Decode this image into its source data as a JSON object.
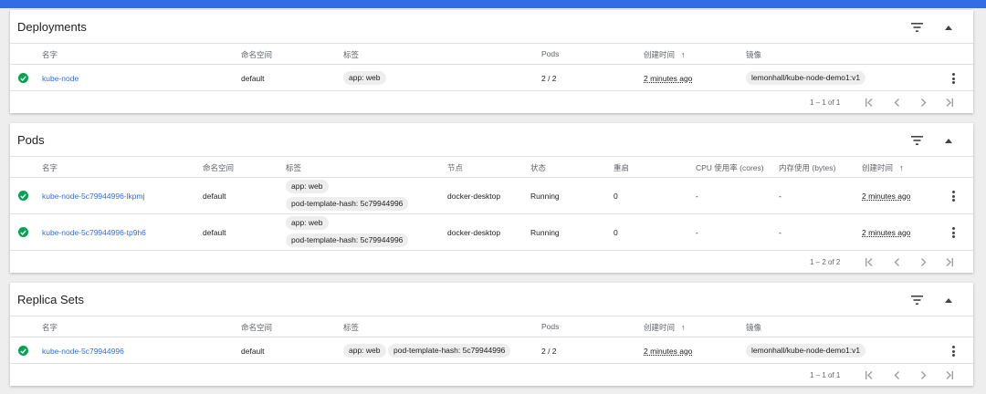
{
  "deployments": {
    "title": "Deployments",
    "columns": {
      "name": "名字",
      "namespace": "命名空间",
      "labels": "标签",
      "pods": "Pods",
      "created": "创建时间",
      "images": "镜像"
    },
    "rows": [
      {
        "name": "kube-node",
        "namespace": "default",
        "labels": [
          "app: web"
        ],
        "pods": "2 / 2",
        "created": "2 minutes ago",
        "image": "lemonhall/kube-node-demo1:v1",
        "status": "running"
      }
    ],
    "range": "1 – 1 of 1"
  },
  "pods": {
    "title": "Pods",
    "columns": {
      "name": "名字",
      "namespace": "命名空间",
      "labels": "标签",
      "node": "节点",
      "status": "状态",
      "restarts": "重启",
      "cpu": "CPU 使用率 (cores)",
      "memory": "内存使用 (bytes)",
      "created": "创建时间"
    },
    "rows": [
      {
        "name": "kube-node-5c79944996-lkpmj",
        "namespace": "default",
        "labels": [
          "app: web",
          "pod-template-hash: 5c79944996"
        ],
        "node": "docker-desktop",
        "status": "Running",
        "restarts": "0",
        "cpu": "-",
        "memory": "-",
        "created": "2 minutes ago"
      },
      {
        "name": "kube-node-5c79944996-tp9h6",
        "namespace": "default",
        "labels": [
          "app: web",
          "pod-template-hash: 5c79944996"
        ],
        "node": "docker-desktop",
        "status": "Running",
        "restarts": "0",
        "cpu": "-",
        "memory": "-",
        "created": "2 minutes ago"
      }
    ],
    "range": "1 – 2 of 2"
  },
  "replicasets": {
    "title": "Replica Sets",
    "columns": {
      "name": "名字",
      "namespace": "命名空间",
      "labels": "标签",
      "pods": "Pods",
      "created": "创建时间",
      "images": "镜像"
    },
    "rows": [
      {
        "name": "kube-node-5c79944996",
        "namespace": "default",
        "labels": [
          "app: web",
          "pod-template-hash: 5c79944996"
        ],
        "pods": "2 / 2",
        "created": "2 minutes ago",
        "image": "lemonhall/kube-node-demo1:v1",
        "status": "running"
      }
    ],
    "range": "1 – 1 of 1"
  },
  "icons": {
    "filter": "filter-icon",
    "collapse": "chevron-up-icon",
    "status": "check-circle-icon",
    "menu": "more-vert-icon",
    "first": "first-page-icon",
    "prev": "chevron-left-icon",
    "next": "chevron-right-icon",
    "last": "last-page-icon"
  },
  "colors": {
    "accent": "#326de6",
    "success": "#00a34e",
    "link": "#326de6"
  }
}
